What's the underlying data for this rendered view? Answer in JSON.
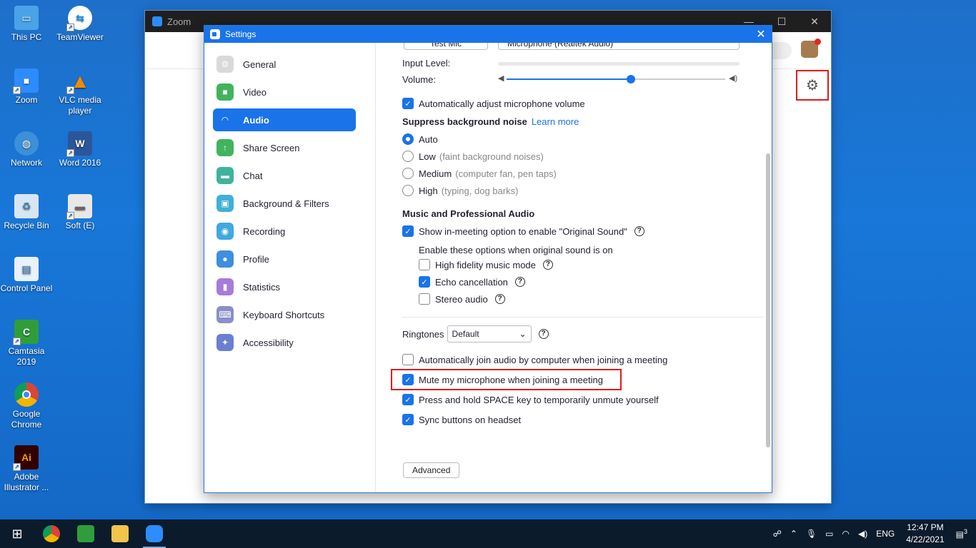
{
  "desktop": {
    "icons": [
      {
        "label": "This PC",
        "icon": "this-pc-icon"
      },
      {
        "label": "TeamViewer",
        "icon": "teamviewer-icon"
      },
      {
        "label": "Zoom",
        "icon": "zoom-icon"
      },
      {
        "label": "VLC media player",
        "icon": "vlc-icon"
      },
      {
        "label": "Network",
        "icon": "network-icon"
      },
      {
        "label": "Word 2016",
        "icon": "word-icon"
      },
      {
        "label": "Recycle Bin",
        "icon": "recycle-bin-icon"
      },
      {
        "label": "Soft (E)",
        "icon": "drive-icon"
      },
      {
        "label": "Control Panel",
        "icon": "control-panel-icon"
      },
      {
        "label": "Camtasia 2019",
        "icon": "camtasia-icon"
      },
      {
        "label": "Google Chrome",
        "icon": "chrome-icon"
      },
      {
        "label": "Adobe Illustrator ...",
        "icon": "illustrator-icon"
      }
    ]
  },
  "zoom_window": {
    "title": "Zoom",
    "min": "—",
    "max": "☐",
    "close": "✕",
    "gear": "⚙"
  },
  "settings": {
    "title": "Settings",
    "close": "✕",
    "nav": [
      {
        "label": "General",
        "color": "#d9d9d9",
        "glyph": "⚙"
      },
      {
        "label": "Video",
        "color": "#41b35d",
        "glyph": "■"
      },
      {
        "label": "Audio",
        "color": "#1a73e8",
        "glyph": "◠"
      },
      {
        "label": "Share Screen",
        "color": "#41b35d",
        "glyph": "↑"
      },
      {
        "label": "Chat",
        "color": "#3fb39b",
        "glyph": "▬"
      },
      {
        "label": "Background & Filters",
        "color": "#3fb0d6",
        "glyph": "▣"
      },
      {
        "label": "Recording",
        "color": "#3fa9e0",
        "glyph": "◉"
      },
      {
        "label": "Profile",
        "color": "#3f8fe0",
        "glyph": "●"
      },
      {
        "label": "Statistics",
        "color": "#a77bd9",
        "glyph": "▮"
      },
      {
        "label": "Keyboard Shortcuts",
        "color": "#8a8fc7",
        "glyph": "⌨"
      },
      {
        "label": "Accessibility",
        "color": "#6a7fd1",
        "glyph": "✦"
      }
    ],
    "audio": {
      "test_mic": "Test Mic",
      "mic_select": "Microphone (Realtek Audio)",
      "input_level_label": "Input Level:",
      "volume_label": "Volume:",
      "volume_fraction": 0.57,
      "auto_adjust": {
        "label": "Automatically adjust microphone volume",
        "checked": true
      },
      "suppress_heading": "Suppress background noise",
      "learn_more": "Learn more",
      "noise_options": [
        {
          "label": "Auto",
          "hint": "",
          "selected": true
        },
        {
          "label": "Low",
          "hint": "(faint background noises)",
          "selected": false
        },
        {
          "label": "Medium",
          "hint": "(computer fan, pen taps)",
          "selected": false
        },
        {
          "label": "High",
          "hint": "(typing, dog barks)",
          "selected": false
        }
      ],
      "music_heading": "Music and Professional Audio",
      "original_sound": {
        "label": "Show in-meeting option to enable \"Original Sound\"",
        "checked": true
      },
      "enable_options_label": "Enable these options when original sound is on",
      "sub_options": [
        {
          "label": "High fidelity music mode",
          "checked": false
        },
        {
          "label": "Echo cancellation",
          "checked": true
        },
        {
          "label": "Stereo audio",
          "checked": false
        }
      ],
      "ringtones_label": "Ringtones",
      "ringtone_value": "Default",
      "bottom_options": [
        {
          "label": "Automatically join audio by computer when joining a meeting",
          "checked": false
        },
        {
          "label": "Mute my microphone when joining a meeting",
          "checked": true
        },
        {
          "label": "Press and hold SPACE key to temporarily unmute yourself",
          "checked": true
        },
        {
          "label": "Sync buttons on headset",
          "checked": true
        }
      ],
      "advanced": "Advanced"
    }
  },
  "taskbar": {
    "lang": "ENG",
    "time": "12:47 PM",
    "date": "4/22/2021",
    "notifications": "3"
  }
}
